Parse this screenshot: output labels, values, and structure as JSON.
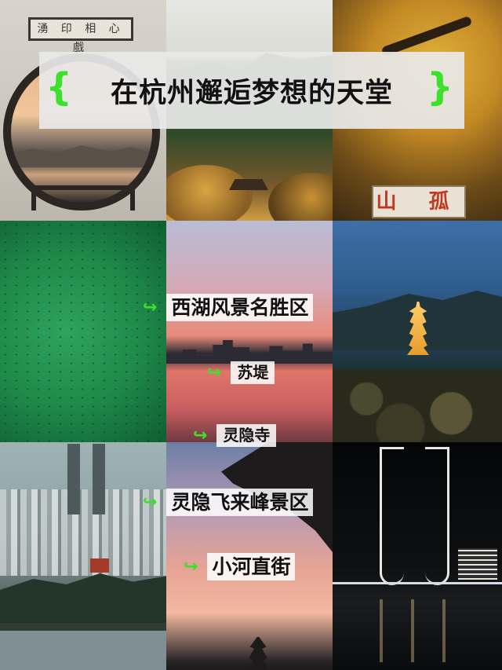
{
  "title": {
    "left_brace": "{",
    "text": "在杭州邂逅梦想的天堂",
    "right_brace": "}"
  },
  "tiles": {
    "moongate_plaque": "湧 印 相 心 戲",
    "hill_sign": "山 孤"
  },
  "labels": [
    {
      "text": "西湖风景名胜区",
      "icon": "green-curved-arrow-icon"
    },
    {
      "text": "苏堤",
      "icon": "green-curved-arrow-icon"
    },
    {
      "text": "灵隐寺",
      "icon": "green-curved-arrow-icon"
    },
    {
      "text": "灵隐飞来峰景区",
      "icon": "green-curved-arrow-icon"
    },
    {
      "text": "小河直街",
      "icon": "green-curved-arrow-icon"
    }
  ],
  "colors": {
    "accent": "#3ce12c",
    "banner": "#e8e8e8",
    "text": "#111111"
  }
}
